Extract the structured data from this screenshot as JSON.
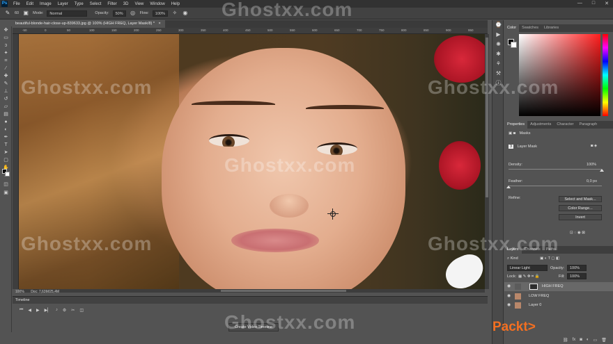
{
  "app": {
    "logo": "Ps"
  },
  "menu": [
    "File",
    "Edit",
    "Image",
    "Layer",
    "Type",
    "Select",
    "Filter",
    "3D",
    "View",
    "Window",
    "Help"
  ],
  "window_controls": [
    "—",
    "□",
    "✕"
  ],
  "options_bar": {
    "brush_size": "60",
    "mode_label": "Mode:",
    "mode_value": "Normal",
    "opacity_label": "Opacity:",
    "opacity_value": "50%",
    "flow_label": "Flow:",
    "flow_value": "100%"
  },
  "document": {
    "tab_title": "beautiful-blonde-hair-close-up-839633.jpg @ 100% (HIGH FREQ, Layer Mask/8) *",
    "zoom": "100%",
    "doc_info": "Doc: 7,63M/25,4M",
    "ruler_numbers": [
      "-50",
      "0",
      "50",
      "100",
      "150",
      "200",
      "250",
      "300",
      "350",
      "400",
      "450",
      "500",
      "550",
      "600",
      "650",
      "700",
      "750",
      "800",
      "850",
      "900",
      "950",
      "1000"
    ]
  },
  "timeline": {
    "title": "Timeline",
    "create_button": "Create Video Timeline"
  },
  "color_panel": {
    "tabs": [
      "Color",
      "Swatches",
      "Libraries"
    ],
    "active_tab": "Color"
  },
  "properties_panel": {
    "tabs": [
      "Properties",
      "Adjustments",
      "Character",
      "Paragraph"
    ],
    "section": "Masks",
    "mask_type": "Layer Mask",
    "density_label": "Density:",
    "density_value": "100%",
    "density_fraction": 1.0,
    "feather_label": "Feather:",
    "feather_value": "0,0 px",
    "feather_fraction": 0.0,
    "refine_label": "Refine:",
    "buttons": [
      "Select and Mask...",
      "Color Range...",
      "Invert"
    ]
  },
  "layers_panel": {
    "tabs": [
      "Layers",
      "Channels",
      "Paths"
    ],
    "kind_label": "Kind",
    "blend_mode": "Linear Light",
    "opacity_label": "Opacity:",
    "opacity_value": "100%",
    "lock_label": "Lock:",
    "fill_label": "Fill:",
    "fill_value": "100%",
    "layers": [
      {
        "name": "HIGH FREQ",
        "selected": true
      },
      {
        "name": "LOW FREQ",
        "selected": false
      },
      {
        "name": "Layer 0",
        "selected": false
      }
    ]
  },
  "watermarks": [
    "Ghostxx.com",
    "Ghostxx.com",
    "Ghostxx.com",
    "Ghostxx.com",
    "Ghostxx.com",
    "Ghostxx.com",
    "Ghostxx.com",
    "Ghostxx.com"
  ],
  "brand": "Packt>"
}
